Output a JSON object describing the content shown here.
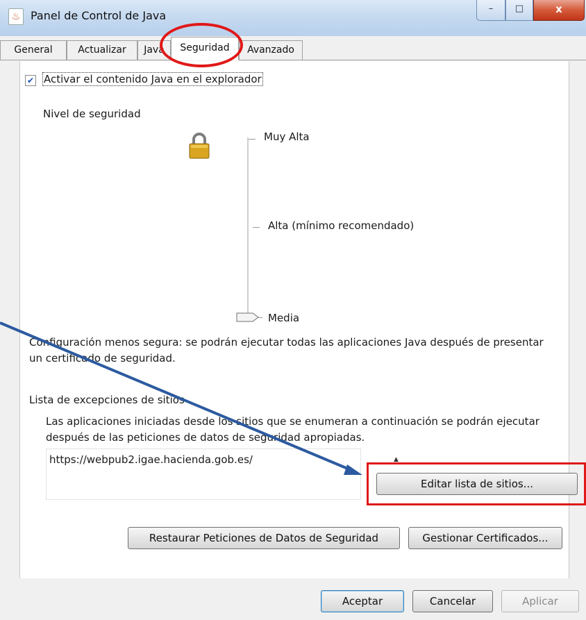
{
  "window": {
    "title": "Panel de Control de Java",
    "controls": {
      "minimize": "–",
      "maximize": "□",
      "close": "x"
    }
  },
  "tabs": [
    {
      "label": "General",
      "active": false
    },
    {
      "label": "Actualizar",
      "active": false
    },
    {
      "label": "Java",
      "active": false
    },
    {
      "label": "Seguridad",
      "active": true
    },
    {
      "label": "Avanzado",
      "active": false
    }
  ],
  "security": {
    "enable_java": {
      "label": "Activar el contenido Java en el explorador",
      "checked": true
    },
    "level_heading": "Nivel de seguridad",
    "levels": [
      "Muy Alta",
      "Alta (mínimo recomendado)",
      "Media"
    ],
    "selected_level": "Media",
    "description": "Configuración menos segura: se podrán ejecutar todas las aplicaciones Java después de presentar",
    "description_line2": "un certificado de seguridad.",
    "exceptions": {
      "heading": "Lista de excepciones de sitios",
      "info_line1": "Las aplicaciones iniciadas desde los sitios que se enumeran a continuación se podrán ejecutar",
      "info_line2": "después de las peticiones de datos de seguridad apropiadas.",
      "sites": [
        "https://webpub2.igae.hacienda.gob.es/"
      ],
      "edit_button": "Editar lista de sitios..."
    },
    "restore_button": "Restaurar Peticiones de Datos de Seguridad",
    "certificates_button": "Gestionar Certificados..."
  },
  "footer": {
    "ok": "Aceptar",
    "cancel": "Cancelar",
    "apply": "Aplicar"
  },
  "colors": {
    "annotation": "#e01818",
    "arrow": "#2c5aa0",
    "lock": "#d9a520"
  }
}
